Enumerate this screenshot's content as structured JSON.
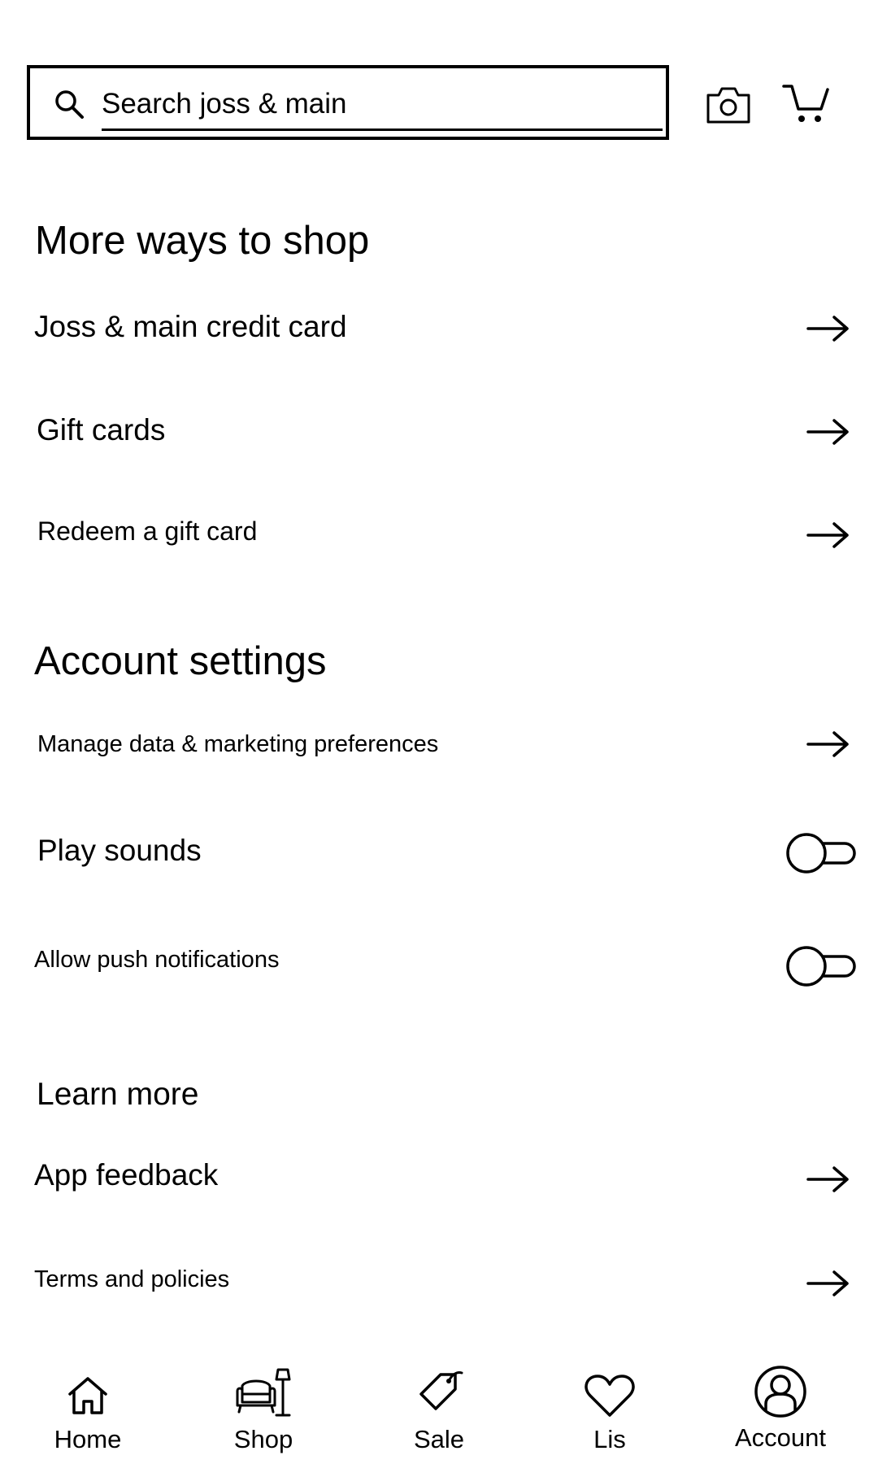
{
  "search": {
    "placeholder": "Search joss & main"
  },
  "sections": {
    "more_ways": {
      "title": "More ways to shop",
      "items": [
        {
          "label": "Joss & main credit card"
        },
        {
          "label": "Gift cards"
        },
        {
          "label": "Redeem a gift card"
        }
      ]
    },
    "account_settings": {
      "title": "Account settings",
      "items": [
        {
          "label": "Manage data & marketing preferences"
        },
        {
          "label": "Play sounds",
          "toggle_on": false
        },
        {
          "label": "Allow push notifications",
          "toggle_on": false
        }
      ]
    },
    "learn_more": {
      "title": "Learn more",
      "items": [
        {
          "label": "App feedback"
        },
        {
          "label": "Terms and policies"
        }
      ]
    }
  },
  "bottom_nav": [
    {
      "label": "Home",
      "icon": "home-icon"
    },
    {
      "label": "Shop",
      "icon": "armchair-lamp-icon"
    },
    {
      "label": "Sale",
      "icon": "tag-icon"
    },
    {
      "label": "Lis",
      "icon": "heart-icon"
    },
    {
      "label": "Account",
      "icon": "account-icon",
      "active": true
    }
  ],
  "colors": {
    "foreground": "#000000",
    "background": "#ffffff"
  }
}
